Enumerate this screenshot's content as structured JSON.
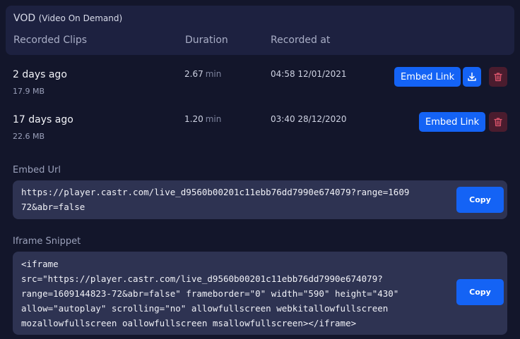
{
  "vod": {
    "title": "VOD",
    "subtitle": "(Video On Demand)",
    "columns": [
      "Recorded Clips",
      "Duration",
      "Recorded at"
    ]
  },
  "clips": [
    {
      "name": "2 days ago",
      "size": "17.9 MB",
      "duration": "2.67",
      "duration_unit": "min",
      "recorded_at": "04:58 12/01/2021",
      "embed_label": "Embed Link",
      "has_download": true
    },
    {
      "name": "17 days ago",
      "size": "22.6 MB",
      "duration": "1.20",
      "duration_unit": "min",
      "recorded_at": "03:40 28/12/2020",
      "embed_label": "Embed Link",
      "has_download": false
    }
  ],
  "embed_url": {
    "label": "Embed Url",
    "value": "https://player.castr.com/live_d9560b00201c11ebb76dd7990e674079?range=1609\n72&abr=false",
    "copy_label": "Copy"
  },
  "iframe_snippet": {
    "label": "Iframe Snippet",
    "value": "<iframe\nsrc=\"https://player.castr.com/live_d9560b00201c11ebb76dd7990e674079?\nrange=1609144823-72&abr=false\" frameborder=\"0\" width=\"590\" height=\"430\"\nallow=\"autoplay\" scrolling=\"no\" allowfullscreen webkitallowfullscreen\nmozallowfullscreen oallowfullscreen msallowfullscreen></iframe>",
    "copy_label": "Copy"
  },
  "colors": {
    "accent": "#1463f5",
    "background": "#13162b",
    "card": "#1d2140",
    "field": "#2e3352",
    "danger_bg": "#4a1c2e",
    "danger_icon": "#e0566e"
  },
  "icons": {
    "download": "download-icon",
    "delete": "trash-icon"
  }
}
